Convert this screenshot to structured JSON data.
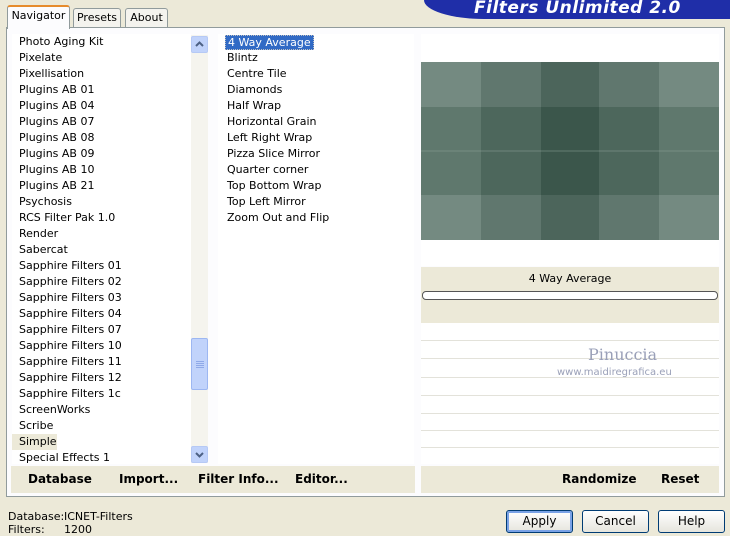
{
  "banner": {
    "title": "Filters Unlimited 2.0"
  },
  "tabs": [
    {
      "label": "Navigator",
      "active": true
    },
    {
      "label": "Presets",
      "active": false
    },
    {
      "label": "About",
      "active": false
    }
  ],
  "categories": {
    "items": [
      "Photo Aging Kit",
      "Pixelate",
      "Pixellisation",
      "Plugins AB 01",
      "Plugins AB 04",
      "Plugins AB 07",
      "Plugins AB 08",
      "Plugins AB 09",
      "Plugins AB 10",
      "Plugins AB 21",
      "Psychosis",
      "RCS Filter Pak 1.0",
      "Render",
      "Sabercat",
      "Sapphire Filters 01",
      "Sapphire Filters 02",
      "Sapphire Filters 03",
      "Sapphire Filters 04",
      "Sapphire Filters 07",
      "Sapphire Filters 10",
      "Sapphire Filters 11",
      "Sapphire Filters 12",
      "Sapphire Filters 1c",
      "ScreenWorks",
      "Scribe",
      "Simple",
      "Special Effects 1"
    ],
    "selected": "Simple"
  },
  "filters": {
    "items": [
      "4 Way Average",
      "Blintz",
      "Centre Tile",
      "Diamonds",
      "Half Wrap",
      "Horizontal Grain",
      "Left Right Wrap",
      "Pizza Slice Mirror",
      "Quarter corner",
      "Top Bottom Wrap",
      "Top Left Mirror",
      "Zoom Out and Flip"
    ],
    "selected": "4 Way Average"
  },
  "preview": {
    "filter_name": "4 Way Average"
  },
  "watermark": {
    "name": "Pinuccia",
    "site": "www.maidiregrafica.eu"
  },
  "toolbar": {
    "database": "Database",
    "import": "Import...",
    "filter_info": "Filter Info...",
    "editor": "Editor...",
    "randomize": "Randomize",
    "reset": "Reset"
  },
  "status": {
    "database_label": "Database:",
    "database_value": "ICNET-Filters",
    "filters_label": "Filters:",
    "filters_value": "1200"
  },
  "buttons": {
    "apply": "Apply",
    "cancel": "Cancel",
    "help": "Help"
  },
  "colors": {
    "banner": "#1f2ea8",
    "selection": "#316ac5",
    "preview_tint": "#4a6458"
  }
}
